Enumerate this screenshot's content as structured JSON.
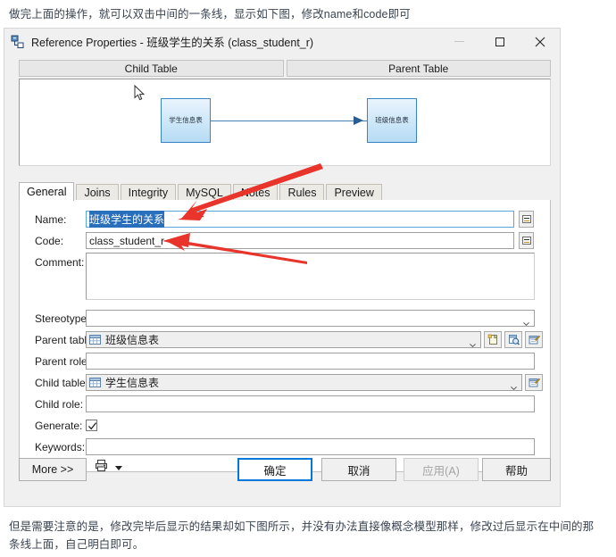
{
  "intro_text": "做完上面的操作，就可以双击中间的一条线，显示如下图，修改name和code即可",
  "outro_text": "但是需要注意的是，修改完毕后显示的结果却如下图所示，并没有办法直接像概念模型那样，修改过后显示在中间的那条线上面，自己明白即可。",
  "window": {
    "title": "Reference Properties - 班级学生的关系 (class_student_r)",
    "icon": "reference-icon",
    "minimize_label": "—",
    "maximize_label": "□",
    "close_label": "✕"
  },
  "preview": {
    "child_header": "Child Table",
    "parent_header": "Parent Table",
    "child_node": "学生信息表",
    "parent_node": "班级信息表"
  },
  "tabs": [
    {
      "label": "General",
      "active": true
    },
    {
      "label": "Joins",
      "active": false
    },
    {
      "label": "Integrity",
      "active": false
    },
    {
      "label": "MySQL",
      "active": false
    },
    {
      "label": "Notes",
      "active": false
    },
    {
      "label": "Rules",
      "active": false
    },
    {
      "label": "Preview",
      "active": false
    }
  ],
  "form": {
    "name_label": "Name:",
    "name_value": "班级学生的关系",
    "code_label": "Code:",
    "code_value": "class_student_r",
    "comment_label": "Comment:",
    "comment_value": "",
    "stereotype_label": "Stereotype:",
    "stereotype_value": "",
    "parent_table_label": "Parent table:",
    "parent_table_value": "班级信息表",
    "parent_role_label": "Parent role:",
    "parent_role_value": "",
    "child_table_label": "Child table:",
    "child_table_value": "学生信息表",
    "child_role_label": "Child role:",
    "child_role_value": "",
    "generate_label": "Generate:",
    "generate_checked": true,
    "keywords_label": "Keywords:",
    "keywords_value": "",
    "equals_button_icon": "equals-properties-icon",
    "create_icon": "new-object-icon",
    "browse_icon": "browse-object-icon",
    "properties_icon": "object-properties-icon",
    "dropdown_icon": "chevron-down-icon"
  },
  "buttons": {
    "more": "More >>",
    "print_icon": "printer-icon",
    "print_dropdown_icon": "caret-down-icon",
    "ok": "确定",
    "cancel": "取消",
    "apply": "应用(A)",
    "apply_disabled": true,
    "help": "帮助"
  },
  "colors": {
    "accent": "#0078d7",
    "selection": "#2a6fbb",
    "node_border": "#3b84c4",
    "annotation_red": "#e8342a",
    "dialog_bg": "#f0f0f0"
  }
}
